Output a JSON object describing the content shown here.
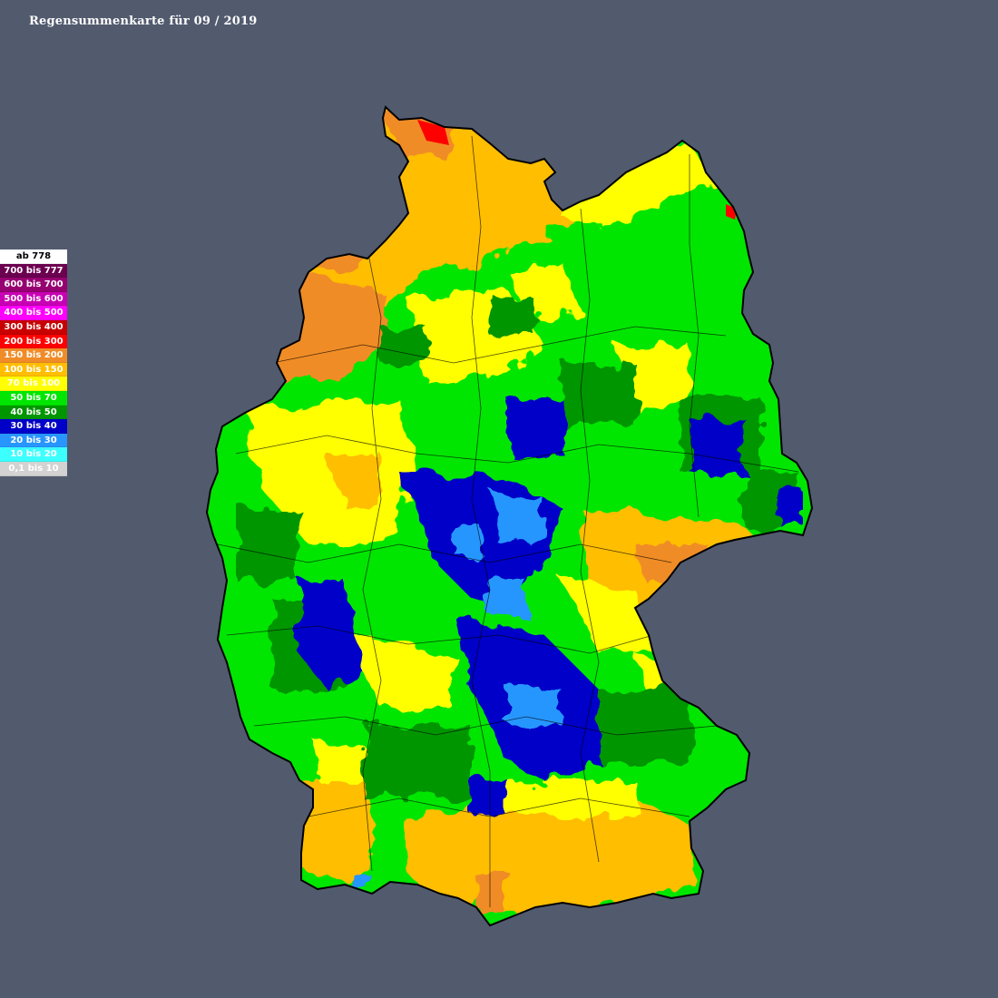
{
  "title": "Regensummenkarte für 09 / 2019",
  "legend": [
    {
      "label": "ab 778",
      "color": "#ffffff",
      "text_color": "#000000"
    },
    {
      "label": "700 bis 777",
      "color": "#6b0050",
      "text_color": "#ffffff"
    },
    {
      "label": "600 bis 700",
      "color": "#960070",
      "text_color": "#ffffff"
    },
    {
      "label": "500 bis 600",
      "color": "#c800b4",
      "text_color": "#ffffff"
    },
    {
      "label": "400 bis 500",
      "color": "#ff00ff",
      "text_color": "#ffffff"
    },
    {
      "label": "300 bis 400",
      "color": "#c80000",
      "text_color": "#ffffff"
    },
    {
      "label": "200 bis 300",
      "color": "#ff0000",
      "text_color": "#ffffff"
    },
    {
      "label": "150 bis 200",
      "color": "#f08c28",
      "text_color": "#ffffff"
    },
    {
      "label": "100 bis 150",
      "color": "#ffbe00",
      "text_color": "#ffffff"
    },
    {
      "label": "70 bis 100",
      "color": "#ffff00",
      "text_color": "#ffffff"
    },
    {
      "label": "50 bis 70",
      "color": "#00e600",
      "text_color": "#ffffff"
    },
    {
      "label": "40 bis 50",
      "color": "#009600",
      "text_color": "#ffffff"
    },
    {
      "label": "30 bis 40",
      "color": "#0000c8",
      "text_color": "#ffffff"
    },
    {
      "label": "20 bis 30",
      "color": "#2896ff",
      "text_color": "#ffffff"
    },
    {
      "label": "10 bis 20",
      "color": "#3cffff",
      "text_color": "#ffffff"
    },
    {
      "label": "0,1 bis 10",
      "color": "#d2d2d2",
      "text_color": "#ffffff"
    }
  ],
  "colors": {
    "background": "#525a6e",
    "border": "#000000"
  }
}
